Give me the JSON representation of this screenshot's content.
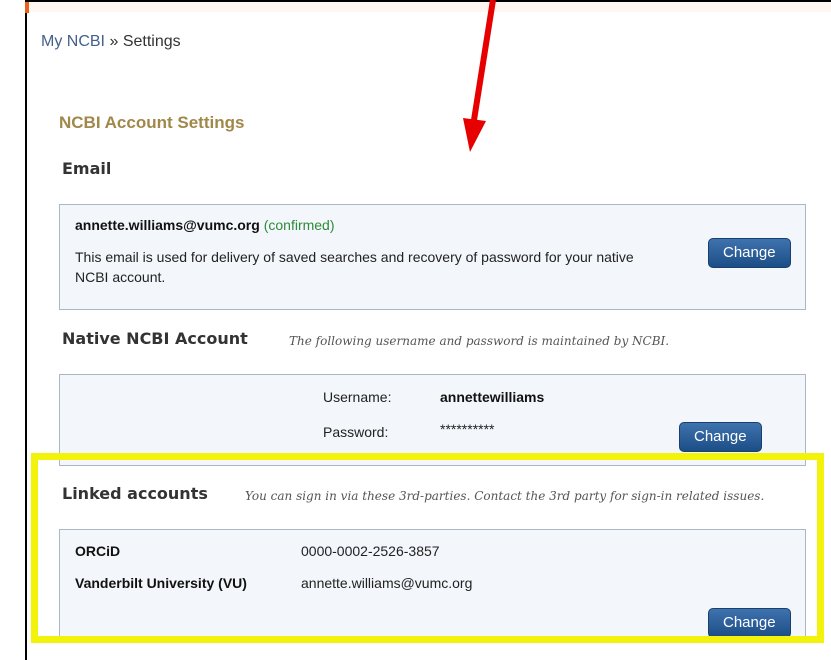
{
  "breadcrumb": {
    "root": "My NCBI",
    "separator": "»",
    "current": "Settings"
  },
  "page_title": "NCBI Account Settings",
  "email_section": {
    "heading": "Email",
    "address": "annette.williams@vumc.org",
    "status": "(confirmed)",
    "description": "This email is used for delivery of saved searches and recovery of password for your native NCBI account.",
    "button": "Change"
  },
  "native_section": {
    "heading": "Native NCBI Account",
    "note": "The following username and password is maintained by NCBI.",
    "username_label": "Username:",
    "username_value": "annettewilliams",
    "password_label": "Password:",
    "password_value": "**********",
    "button": "Change"
  },
  "linked_section": {
    "heading": "Linked accounts",
    "note": "You can sign in via these 3rd-parties. Contact the 3rd party for sign-in related issues.",
    "rows": [
      {
        "provider": "ORCiD",
        "id": "0000-0002-2526-3857"
      },
      {
        "provider": "Vanderbilt University (VU)",
        "id": "annette.williams@vumc.org"
      }
    ],
    "button": "Change"
  },
  "colors": {
    "gold_heading": "#a1884a",
    "link_blue": "#44608c",
    "button_blue": "#2a5d98",
    "confirmed_green": "#2e8b3a",
    "highlight_yellow": "#f2f20a",
    "arrow_red": "#e60000"
  }
}
